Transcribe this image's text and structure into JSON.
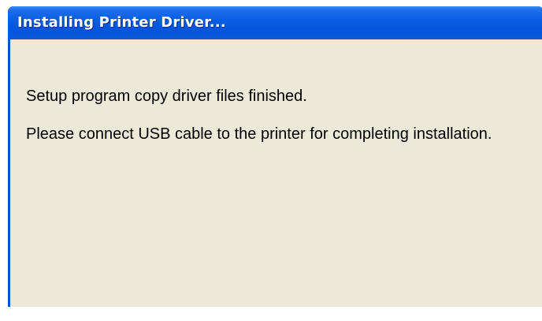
{
  "dialog": {
    "title": "Installing Printer Driver...",
    "message_line1": "Setup program copy driver files finished.",
    "message_line2": "Please connect USB cable to the printer for completing installation."
  },
  "colors": {
    "titlebar": "#0a5ee2",
    "client_background": "#ece9d8",
    "title_text": "#ffffff",
    "body_text": "#000000"
  }
}
